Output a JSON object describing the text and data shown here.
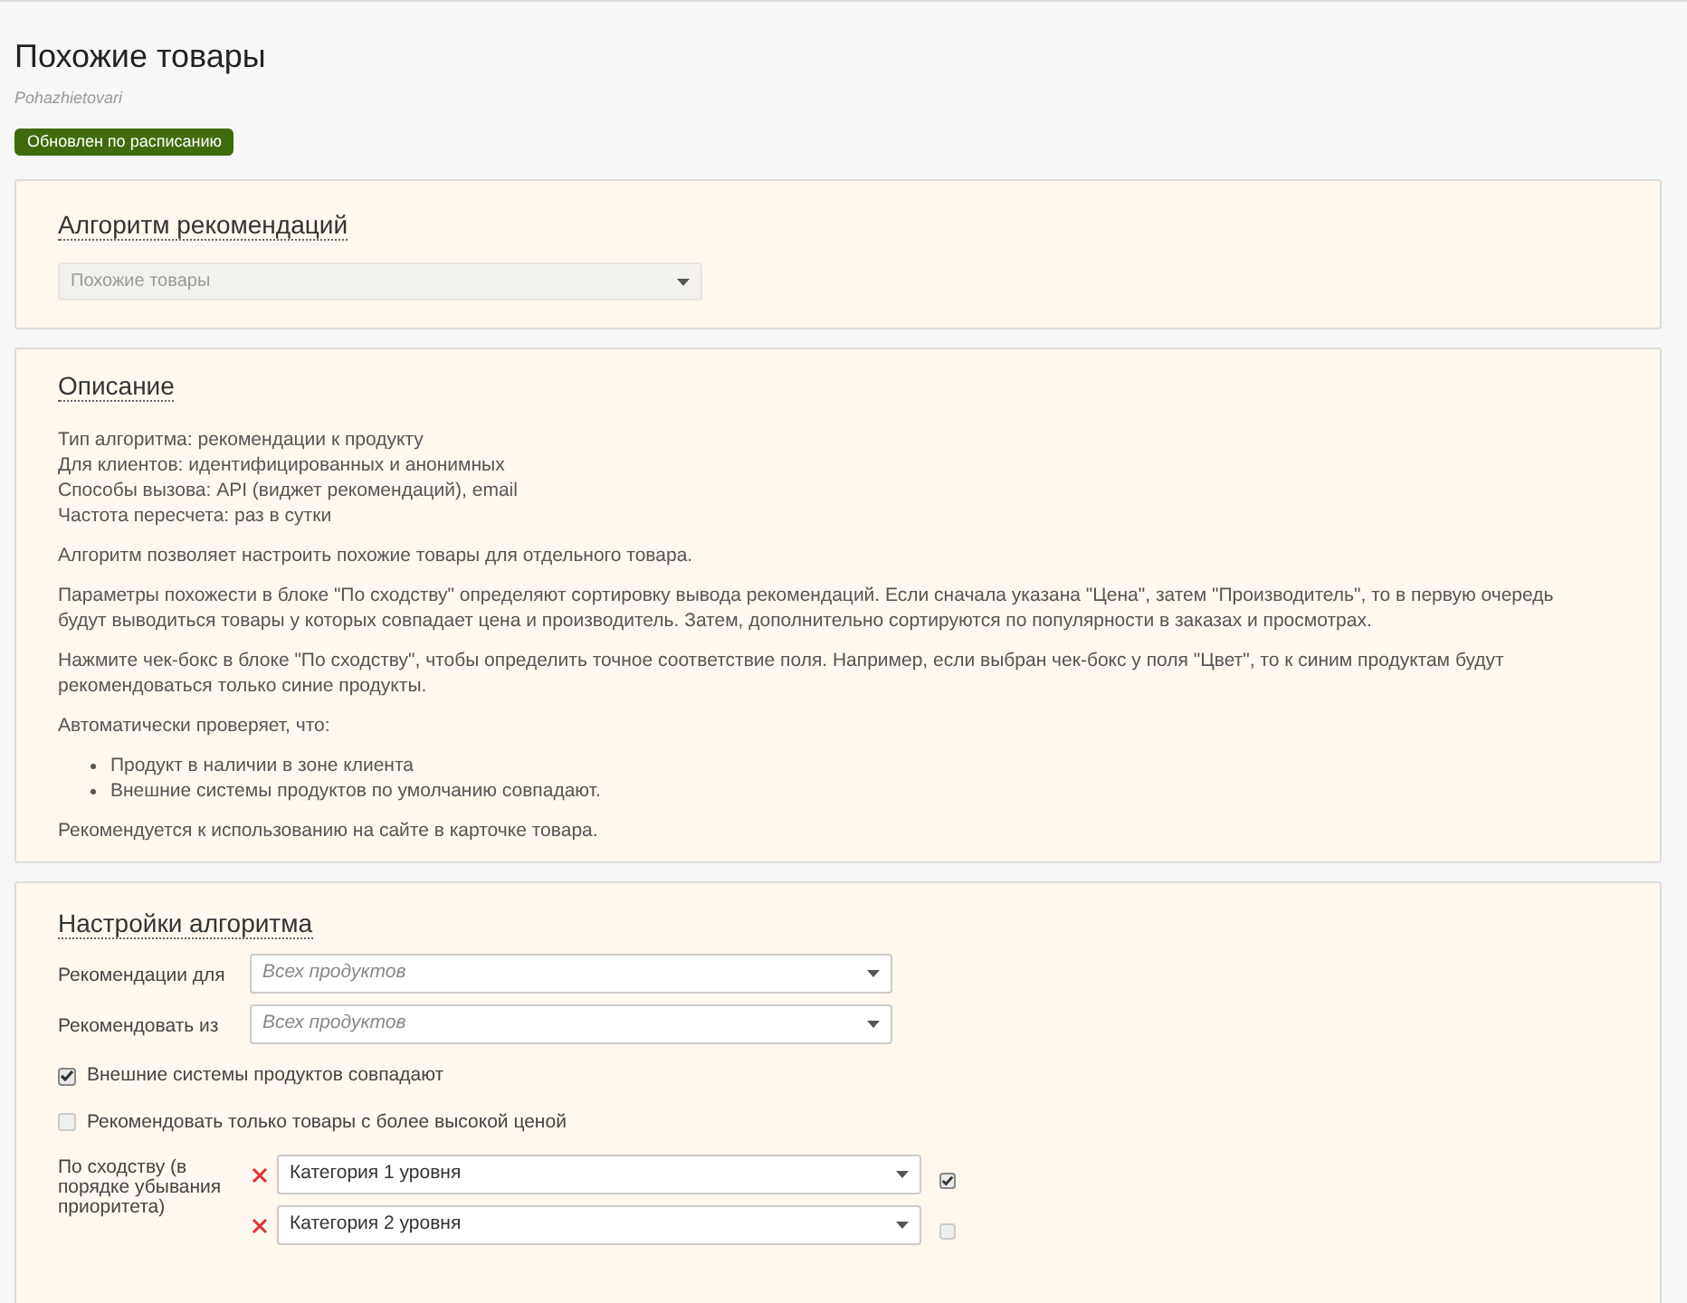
{
  "page": {
    "title": "Похожие товары",
    "slug": "Pohazhietovari",
    "status_badge": "Обновлен по расписанию"
  },
  "algorithm_card": {
    "title": "Алгоритм рекомендаций",
    "select": {
      "value": "Похожие товары",
      "disabled": true
    }
  },
  "description_card": {
    "title": "Описание",
    "meta_lines": [
      "Тип алгоритма: рекомендации к продукту",
      "Для клиентов: идентифицированных и анонимных",
      "Способы вызова: API (виджет рекомендаций), email",
      "Частота пересчета: раз в сутки"
    ],
    "paragraphs": [
      "Алгоритм позволяет настроить похожие товары для отдельного товара.",
      "Параметры похожести в блоке \"По сходству\" определяют сортировку вывода рекомендаций. Если сначала указана \"Цена\", затем \"Производитель\", то в первую очередь будут выводиться товары у которых совпадает цена и производитель. Затем, дополнительно сортируются по популярности в заказах и просмотрах.",
      "Нажмите чек-бокс в блоке \"По сходству\", чтобы определить точное соответствие поля. Например, если выбран чек-бокс у поля \"Цвет\", то к синим продуктам будут рекомендоваться только синие продукты.",
      "Автоматически проверяет, что:"
    ],
    "bullets": [
      "Продукт в наличии в зоне клиента",
      "Внешние системы продуктов по умолчанию совпадают."
    ],
    "footer": "Рекомендуется к использованию на сайте в карточке товара."
  },
  "settings_card": {
    "title": "Настройки алгоритма",
    "selects": [
      {
        "label": "Рекомендации для",
        "placeholder": "Всех продуктов"
      },
      {
        "label": "Рекомендовать из",
        "placeholder": "Всех продуктов"
      }
    ],
    "checkboxes": [
      {
        "label": "Внешние системы продуктов совпадают",
        "checked": true
      },
      {
        "label": "Рекомендовать только товары с более высокой ценой",
        "checked": false
      }
    ],
    "similarity": {
      "label": "По сходству (в порядке убывания приоритета)",
      "rows": [
        {
          "value": "Категория 1 уровня",
          "exact": true
        },
        {
          "value": "Категория 2 уровня",
          "exact": false
        }
      ]
    }
  }
}
